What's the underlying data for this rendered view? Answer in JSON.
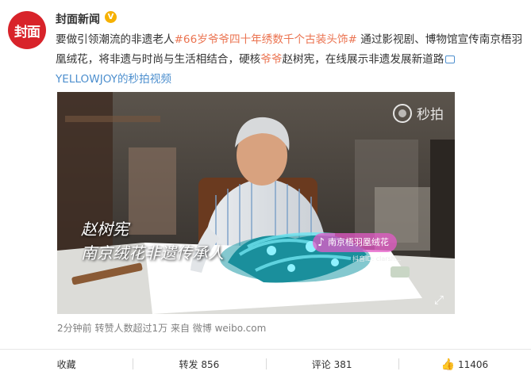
{
  "account": {
    "avatar_text": "封面",
    "name": "封面新闻",
    "verified_icon": "verified-badge-icon",
    "brand_color": "#d8232a"
  },
  "post": {
    "text_1": "要做引领潮流的非遗老人",
    "topic": "#66岁爷爷四十年绣数千个古装头饰#",
    "text_2": " 通过影视剧、博物馆宣传南京梧羽凰绒花，将非遗与时尚与生活相结合，硬核",
    "link": "爷爷",
    "text_3": "赵树宪，在线展示非遗发展新道路",
    "video_source": "YELLOWJOY的秒拍视频",
    "topic_color": "#eb7350",
    "link_color": "#4d8fce"
  },
  "video": {
    "watermark": "秒拍",
    "subtitle_line1": "赵树宪",
    "subtitle_line2": "南京绒花非遗传承人",
    "tiktok_badge": "南京梧羽凰绒花",
    "tiktok_sub": "抖音ID: clarsh..."
  },
  "meta": {
    "time": "2分钟前",
    "reposts_summary": "转赞人数超过1万",
    "source": "来自 微博 weibo.com"
  },
  "actions": {
    "collect": "收藏",
    "repost": "转发 856",
    "comment": "评论 381",
    "like": "11406"
  }
}
